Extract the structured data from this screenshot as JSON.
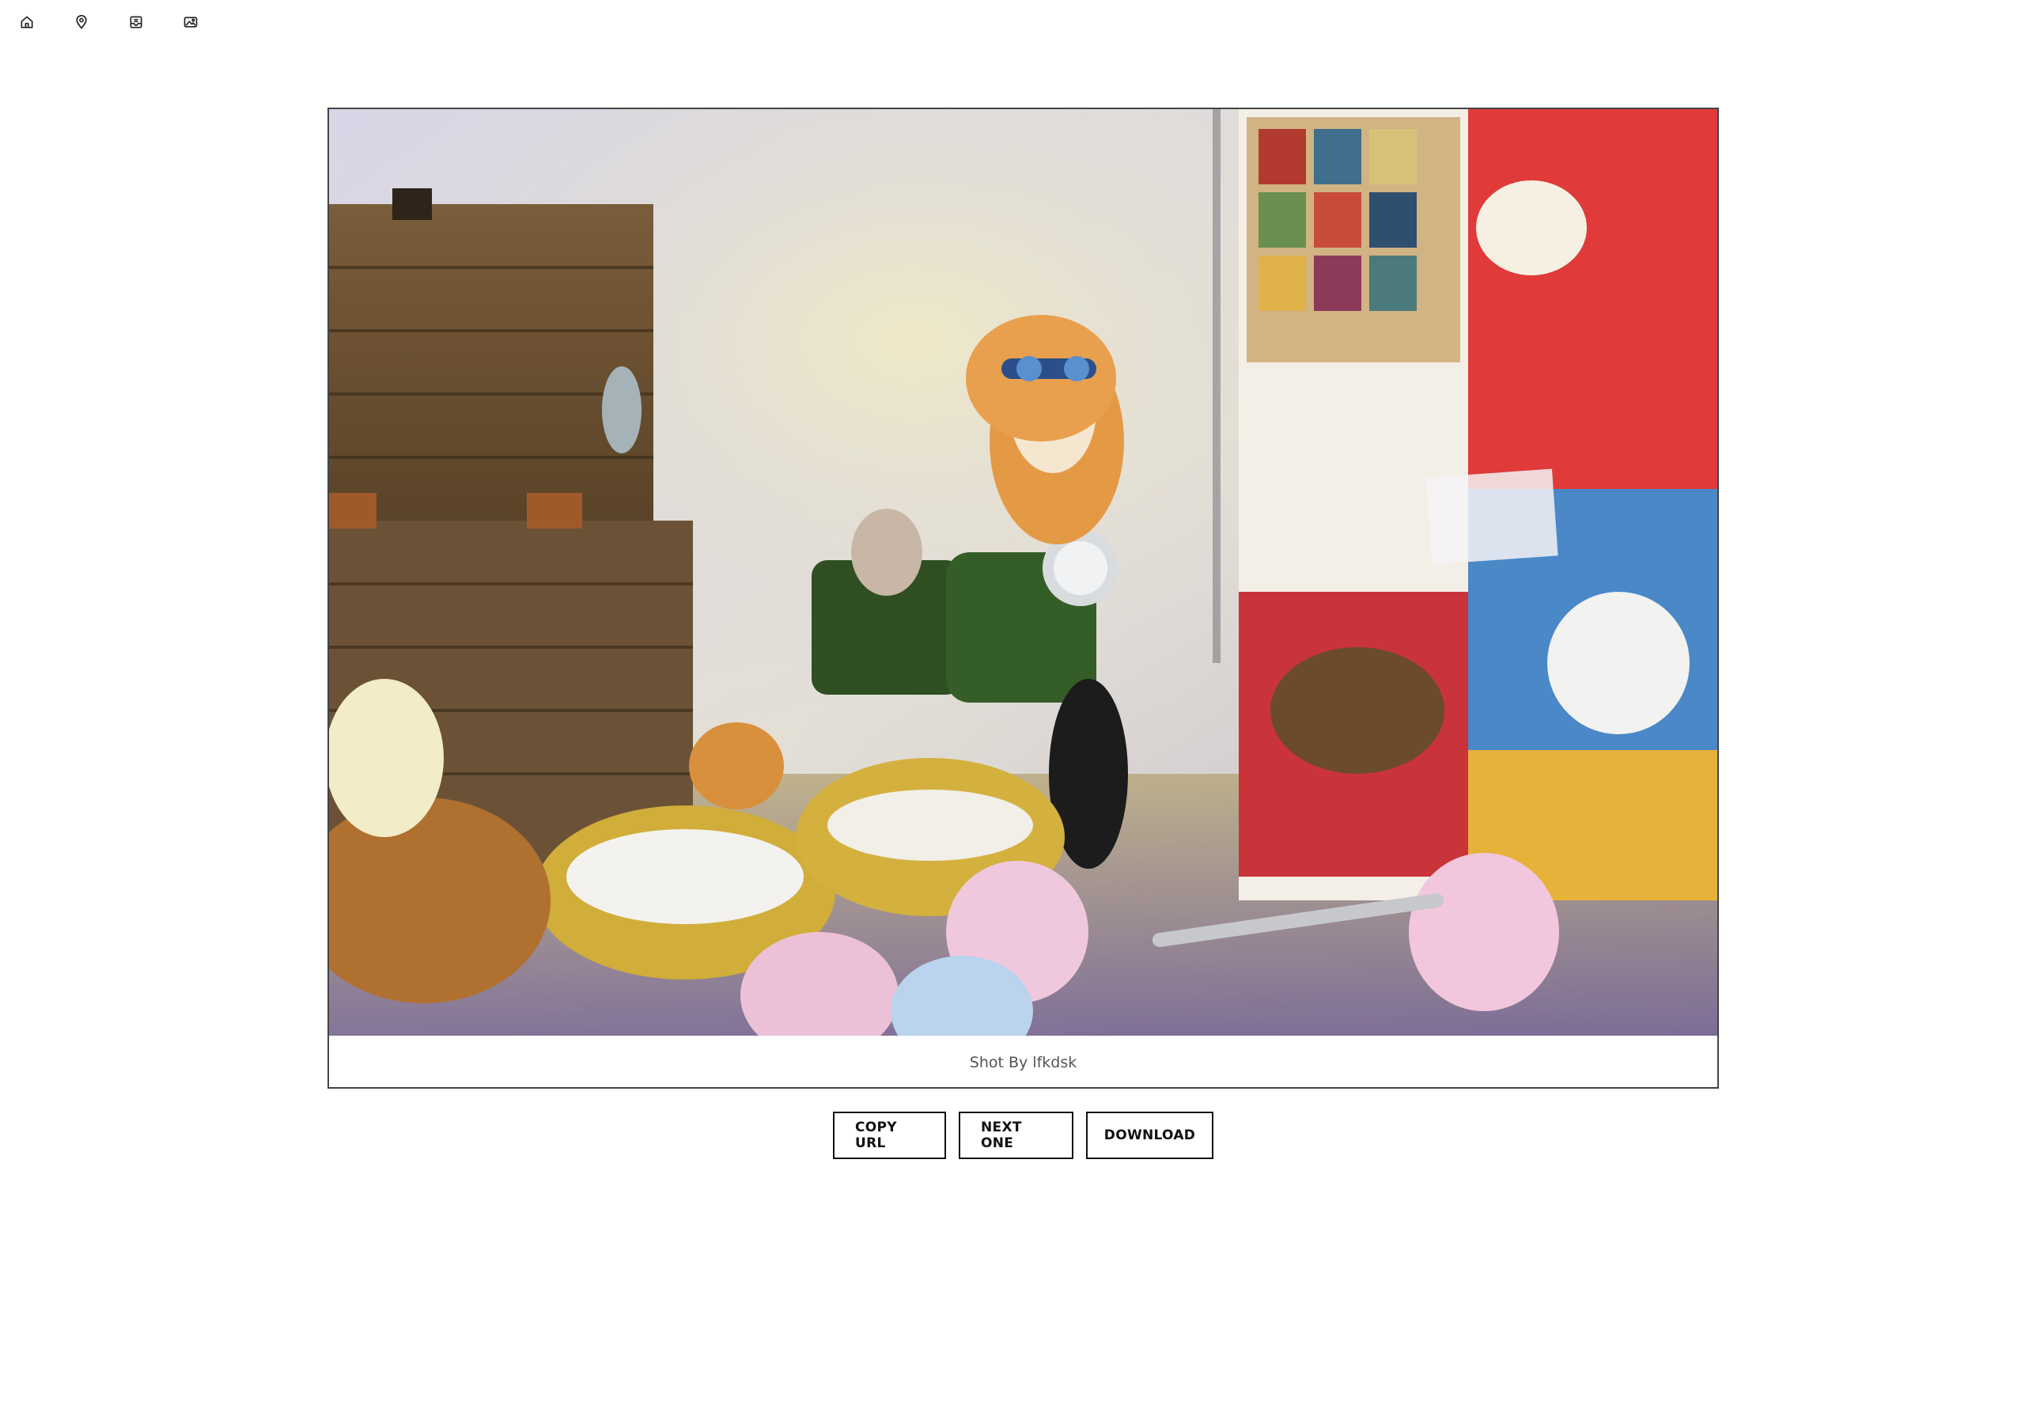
{
  "nav": {
    "items": [
      {
        "icon": "home-icon"
      },
      {
        "icon": "location-pin-icon"
      },
      {
        "icon": "inbox-icon"
      },
      {
        "icon": "image-icon"
      }
    ]
  },
  "photo": {
    "caption": "Shot By lfkdsk"
  },
  "actions": {
    "copy_url": "COPY URL",
    "next_one": "NEXT ONE",
    "download": "DOWNLOAD"
  },
  "colors": {
    "border": "#444444",
    "button_border": "#111111",
    "caption_text": "#555555"
  }
}
